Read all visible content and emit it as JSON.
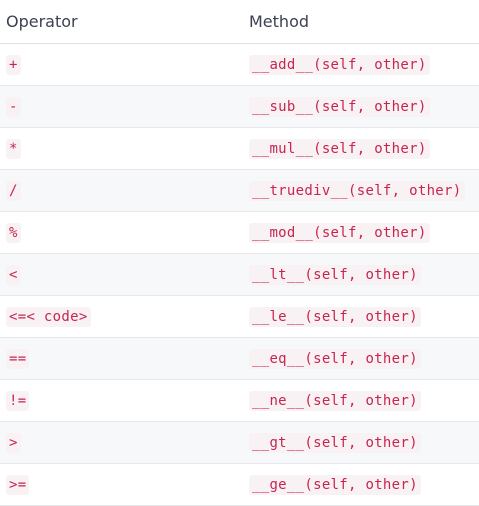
{
  "table": {
    "headers": [
      "Operator",
      "Method"
    ],
    "rows": [
      {
        "operator": "+",
        "method": "__add__(self, other)"
      },
      {
        "operator": "-",
        "method": "__sub__(self, other)"
      },
      {
        "operator": "*",
        "method": "__mul__(self, other)"
      },
      {
        "operator": "/",
        "method": "__truediv__(self, other)"
      },
      {
        "operator": "%",
        "method": "__mod__(self, other)"
      },
      {
        "operator": "<",
        "method": "__lt__(self, other)"
      },
      {
        "operator": "<=< code>",
        "method": "__le__(self, other)"
      },
      {
        "operator": "==",
        "method": "__eq__(self, other)"
      },
      {
        "operator": "!=",
        "method": "__ne__(self, other)"
      },
      {
        "operator": ">",
        "method": "__gt__(self, other)"
      },
      {
        "operator": ">=",
        "method": "__ge__(self, other)"
      }
    ]
  }
}
